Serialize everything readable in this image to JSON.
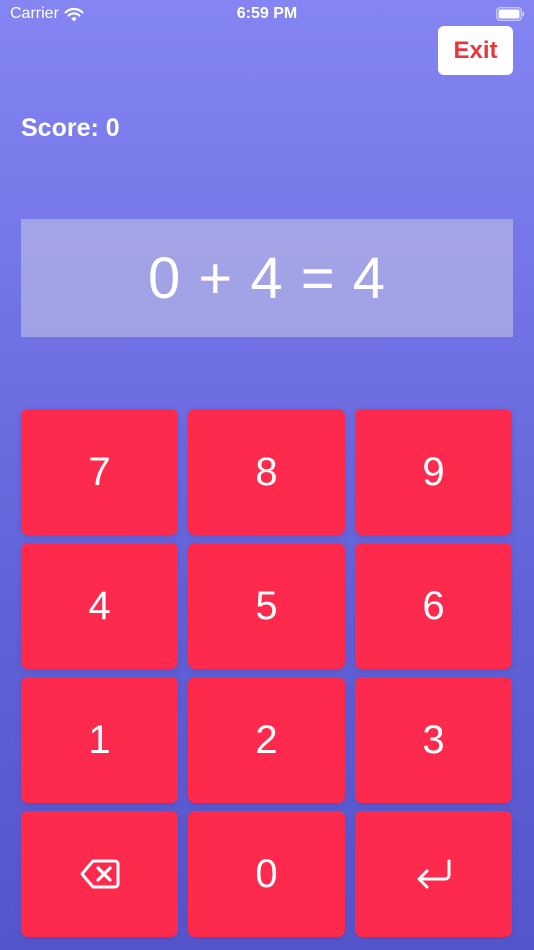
{
  "status_bar": {
    "carrier": "Carrier",
    "time": "6:59 PM",
    "wifi_icon": "wifi-icon",
    "battery_icon": "battery-icon"
  },
  "header": {
    "exit_label": "Exit"
  },
  "score": {
    "label": "Score: 0"
  },
  "equation": {
    "text": "0 + 4 = 4"
  },
  "keypad": {
    "keys": [
      {
        "label": "7"
      },
      {
        "label": "8"
      },
      {
        "label": "9"
      },
      {
        "label": "4"
      },
      {
        "label": "5"
      },
      {
        "label": "6"
      },
      {
        "label": "1"
      },
      {
        "label": "2"
      },
      {
        "label": "3"
      },
      {
        "icon": "backspace-icon"
      },
      {
        "label": "0"
      },
      {
        "icon": "return-icon"
      }
    ]
  },
  "colors": {
    "background_top": "#8485f2",
    "background_bottom": "#5656cc",
    "key": "#fe2a4d",
    "exit_text": "#e8363d",
    "text": "#ffffff"
  }
}
